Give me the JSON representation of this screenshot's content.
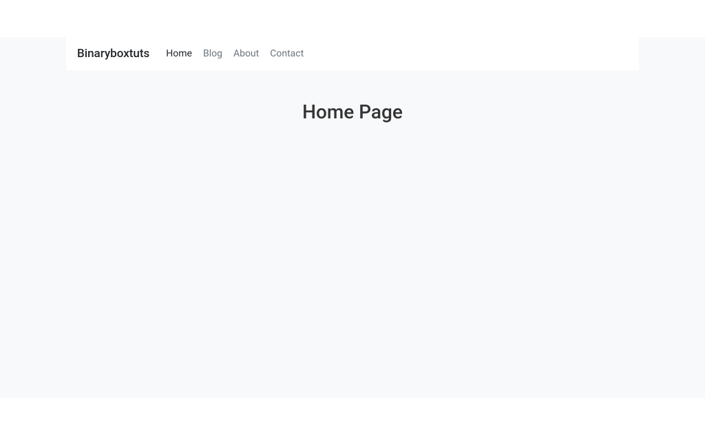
{
  "navbar": {
    "brand": "Binaryboxtuts",
    "links": [
      {
        "label": "Home",
        "active": true
      },
      {
        "label": "Blog",
        "active": false
      },
      {
        "label": "About",
        "active": false
      },
      {
        "label": "Contact",
        "active": false
      }
    ]
  },
  "main": {
    "title": "Home Page"
  }
}
